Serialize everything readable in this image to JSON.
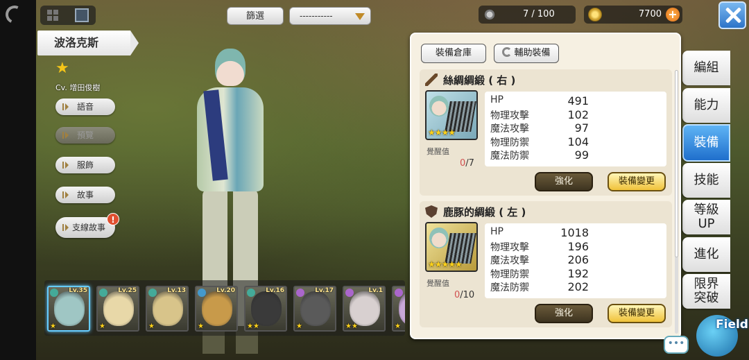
{
  "character": {
    "name": "波洛克斯",
    "rank_star": "★",
    "cv": "Cv. 增田俊樹"
  },
  "side_menu": [
    {
      "label": "語音",
      "enabled": true
    },
    {
      "label": "預覽",
      "enabled": false
    },
    {
      "label": "服飾",
      "enabled": true
    },
    {
      "label": "故事",
      "enabled": true
    },
    {
      "label": "支線故事",
      "enabled": true,
      "alert": "!"
    }
  ],
  "filter": {
    "button_label": "篩選",
    "dropdown_value": "-----------"
  },
  "resources": {
    "stamina": "7 / 100",
    "gold": "7700",
    "add_symbol": "+"
  },
  "tabs": [
    {
      "label": "編組"
    },
    {
      "label": "能力"
    },
    {
      "label": "裝備",
      "active": true
    },
    {
      "label": "技能"
    },
    {
      "label": "等級\nUP"
    },
    {
      "label": "進化"
    },
    {
      "label": "限界\n突破"
    }
  ],
  "panel": {
    "warehouse_label": "裝備倉庫",
    "assist_label": "輔助裝備",
    "awaken_label": "覺醒值",
    "upgrade_label": "強化",
    "change_label": "裝備變更",
    "items": [
      {
        "title": "絲綢綢緞 ( 右 )",
        "icon": "sword-icon",
        "stars": "★★★★",
        "awaken_current": "0",
        "awaken_max": "/7",
        "stats": [
          {
            "name": "HP",
            "value": "491"
          },
          {
            "name": "物理攻擊",
            "value": "102"
          },
          {
            "name": "魔法攻擊",
            "value": "97"
          },
          {
            "name": "物理防禦",
            "value": "104"
          },
          {
            "name": "魔法防禦",
            "value": "99"
          }
        ]
      },
      {
        "title": "鹿豚的綢緞 ( 左 )",
        "icon": "shield-icon",
        "stars": "★★★★★",
        "awaken_current": "0",
        "awaken_max": "/10",
        "stats": [
          {
            "name": "HP",
            "value": "1018"
          },
          {
            "name": "物理攻擊",
            "value": "196"
          },
          {
            "name": "魔法攻擊",
            "value": "206"
          },
          {
            "name": "物理防禦",
            "value": "192"
          },
          {
            "name": "魔法防禦",
            "value": "202"
          }
        ]
      }
    ]
  },
  "roster": [
    {
      "level": "Lv.35",
      "stars": "★",
      "face": "#9fc6c4",
      "elem": "#4a9"
    },
    {
      "level": "Lv.25",
      "stars": "★",
      "face": "#e8d8a8",
      "elem": "#4a9"
    },
    {
      "level": "Lv.13",
      "stars": "★",
      "face": "#d8c48a",
      "elem": "#4a9"
    },
    {
      "level": "Lv.20",
      "stars": "★",
      "face": "#c89a4a",
      "elem": "#49c"
    },
    {
      "level": "Lv.16",
      "stars": "★★",
      "face": "#3a3a3a",
      "elem": "#4a9"
    },
    {
      "level": "Lv.17",
      "stars": "★",
      "face": "#5a5a5a",
      "elem": "#a6c"
    },
    {
      "level": "Lv.1",
      "stars": "★★",
      "face": "#d8d0d0",
      "elem": "#a6c"
    },
    {
      "level": "",
      "stars": "★",
      "face": "#c8a8d8",
      "elem": "#a6c"
    }
  ],
  "field_label": "Field",
  "chat_symbol": "•••"
}
